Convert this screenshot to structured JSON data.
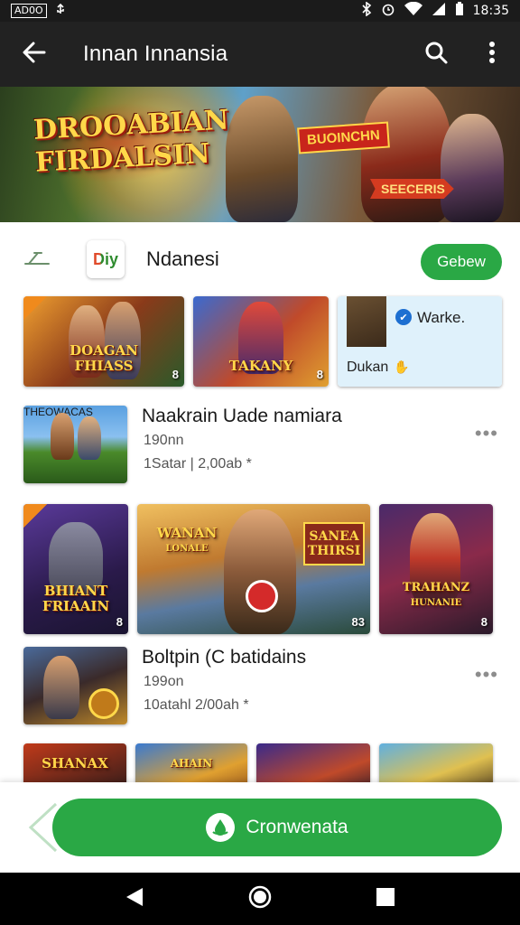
{
  "status_bar": {
    "carrier_badge": "AD0O",
    "time": "18:35",
    "icons": [
      "usb-icon",
      "bluetooth-icon",
      "alarm-icon",
      "wifi-icon",
      "signal-icon",
      "battery-icon"
    ]
  },
  "app_bar": {
    "title": "Innan Innansia",
    "icons": [
      "back-arrow-icon",
      "search-icon",
      "more-vert-icon"
    ]
  },
  "banner": {
    "logo_line1": "DROOABIAN",
    "logo_line2": "FIRDALSIN",
    "tag1": "BUOINCHN",
    "tag2": "SEECERIS"
  },
  "section": {
    "share_icon": "share-icon",
    "app_icon_text": "Diy",
    "app_name": "Ndanesi",
    "follow_label": "Gebew"
  },
  "row1": [
    {
      "caption_line1": "DOAGAN",
      "caption_line2": "FHIASS",
      "number": "8"
    },
    {
      "caption_line1": "TAKANY",
      "caption_line2": "",
      "number": "8"
    },
    {
      "label1": "Warke.",
      "label2": "Dukan"
    }
  ],
  "list_items": [
    {
      "title": "Naakrain Uade namiara",
      "meta1": "190nn",
      "meta2": "1Satar | 2,00ab  *",
      "thumb_caption": "THEOWACAS"
    },
    {
      "title": "Boltpin (C batidains",
      "meta1": "199on",
      "meta2": "10atahl 2/00ah  *",
      "thumb_caption": ""
    }
  ],
  "row2": [
    {
      "caption_line1": "BHIANT",
      "caption_line2": "FRIAAIN",
      "number": "8"
    },
    {
      "caption_line1": "WANAN",
      "caption_line2": "LONALE",
      "side_sign1": "SANEA",
      "side_sign2": "THIRSI",
      "number": "83"
    },
    {
      "caption_line1": "TRAHANZ",
      "caption_line2": "HUNANIE",
      "number": "8"
    }
  ],
  "row3": [
    {
      "caption": "SHANAX"
    },
    {
      "caption": "AHAIN"
    },
    {
      "caption": ""
    },
    {
      "caption": ""
    }
  ],
  "cta": {
    "label": "Cronwenata",
    "icon": "drop-icon"
  },
  "nav_bar": {
    "icons": [
      "nav-back-icon",
      "nav-home-icon",
      "nav-recents-icon"
    ]
  },
  "colors": {
    "accent_green": "#2aa845",
    "app_bar": "#222222",
    "status_bar": "#1b1b1b"
  }
}
